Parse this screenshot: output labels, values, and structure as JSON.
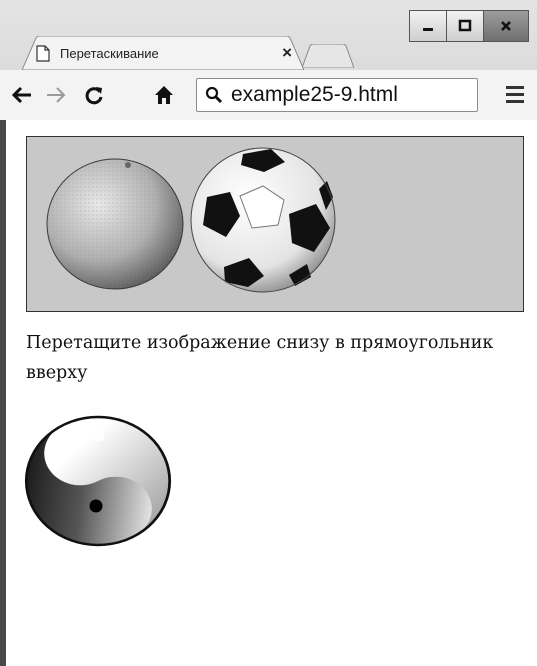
{
  "browser": {
    "tab_title": "Перетаскивание",
    "tab_close": "×",
    "url": "example25-9.html"
  },
  "page": {
    "instruction": "Перетащите изображение снизу в прямоугольник вверху",
    "drop_zone_images": [
      "orange",
      "soccer-ball"
    ],
    "draggable_image": "yin-yang"
  },
  "icons": {
    "minimize": "minimize-icon",
    "maximize": "maximize-icon",
    "close": "close-window-icon",
    "back": "back-arrow-icon",
    "forward": "forward-arrow-icon",
    "reload": "reload-icon",
    "home": "home-icon",
    "search": "search-icon",
    "menu": "hamburger-menu-icon"
  },
  "colors": {
    "drop_zone_bg": "#c8c8c8",
    "chrome_bg": "#dcdcdc"
  }
}
